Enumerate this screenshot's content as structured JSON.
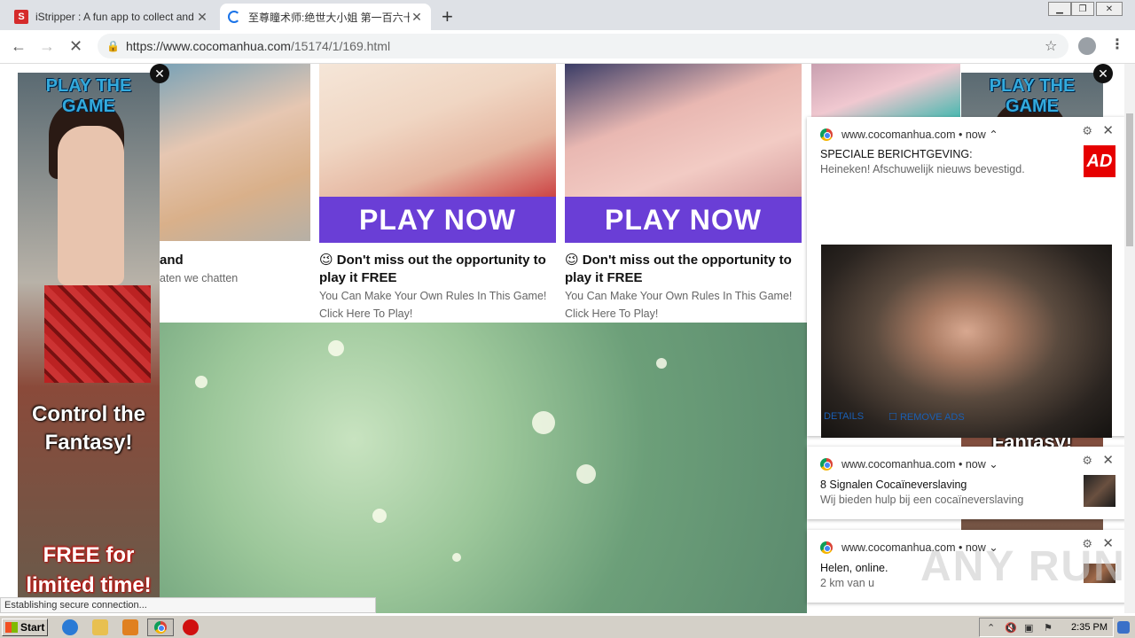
{
  "tabs": [
    {
      "favicon": "S",
      "title": "iStripper : A fun app to collect and w"
    },
    {
      "title": "至尊瞳术师:绝世大小姐 第一百六十"
    }
  ],
  "toolbar": {
    "url_host": "https://www.cocomanhua.com",
    "url_path": "/15174/1/169.html"
  },
  "left_ad": {
    "top_text": "PLAY THE GAME",
    "mid_text": "Control the Fantasy!",
    "bottom_text": "FREE for limited time!"
  },
  "right_ad": {
    "top_text": "PLAY THE GAME",
    "mid_text": "Fantasy!"
  },
  "cards": [
    {
      "title": "and",
      "sub": "aten we chatten"
    },
    {
      "button": "PLAY NOW",
      "title": "😉 Don't miss out the opportunity to play it FREE",
      "sub": "You Can Make Your Own Rules In This Game! Click Here To Play!"
    },
    {
      "button": "PLAY NOW",
      "title": "😉 Don't miss out the opportunity to play it FREE",
      "sub": "You Can Make Your Own Rules In This Game! Click Here To Play!"
    }
  ],
  "notifications": [
    {
      "source": "www.cocomanhua.com • now",
      "chevron": "⌃",
      "title": "SPECIALE BERICHTGEVING:",
      "message": "Heineken! Afschuwelijk nieuws bevestigd.",
      "icon_label": "AD",
      "actions": [
        "DETAILS",
        "REMOVE ADS"
      ]
    },
    {
      "source": "www.cocomanhua.com • now",
      "chevron": "⌄",
      "title": "8 Signalen Cocaïneverslaving",
      "message": "Wij bieden hulp bij een cocaïneverslaving"
    },
    {
      "source": "www.cocomanhua.com • now",
      "chevron": "⌄",
      "title": "Helen, online.",
      "message": "2 km van u"
    }
  ],
  "status_text": "Establishing secure connection...",
  "watermark": "ANY RUN",
  "taskbar": {
    "start_label": "Start",
    "clock": "2:35 PM"
  },
  "colors": {
    "play_now_bg": "#6a3ed6",
    "ad_logo_bg": "#e60000",
    "link_blue": "#1a5fb4"
  }
}
